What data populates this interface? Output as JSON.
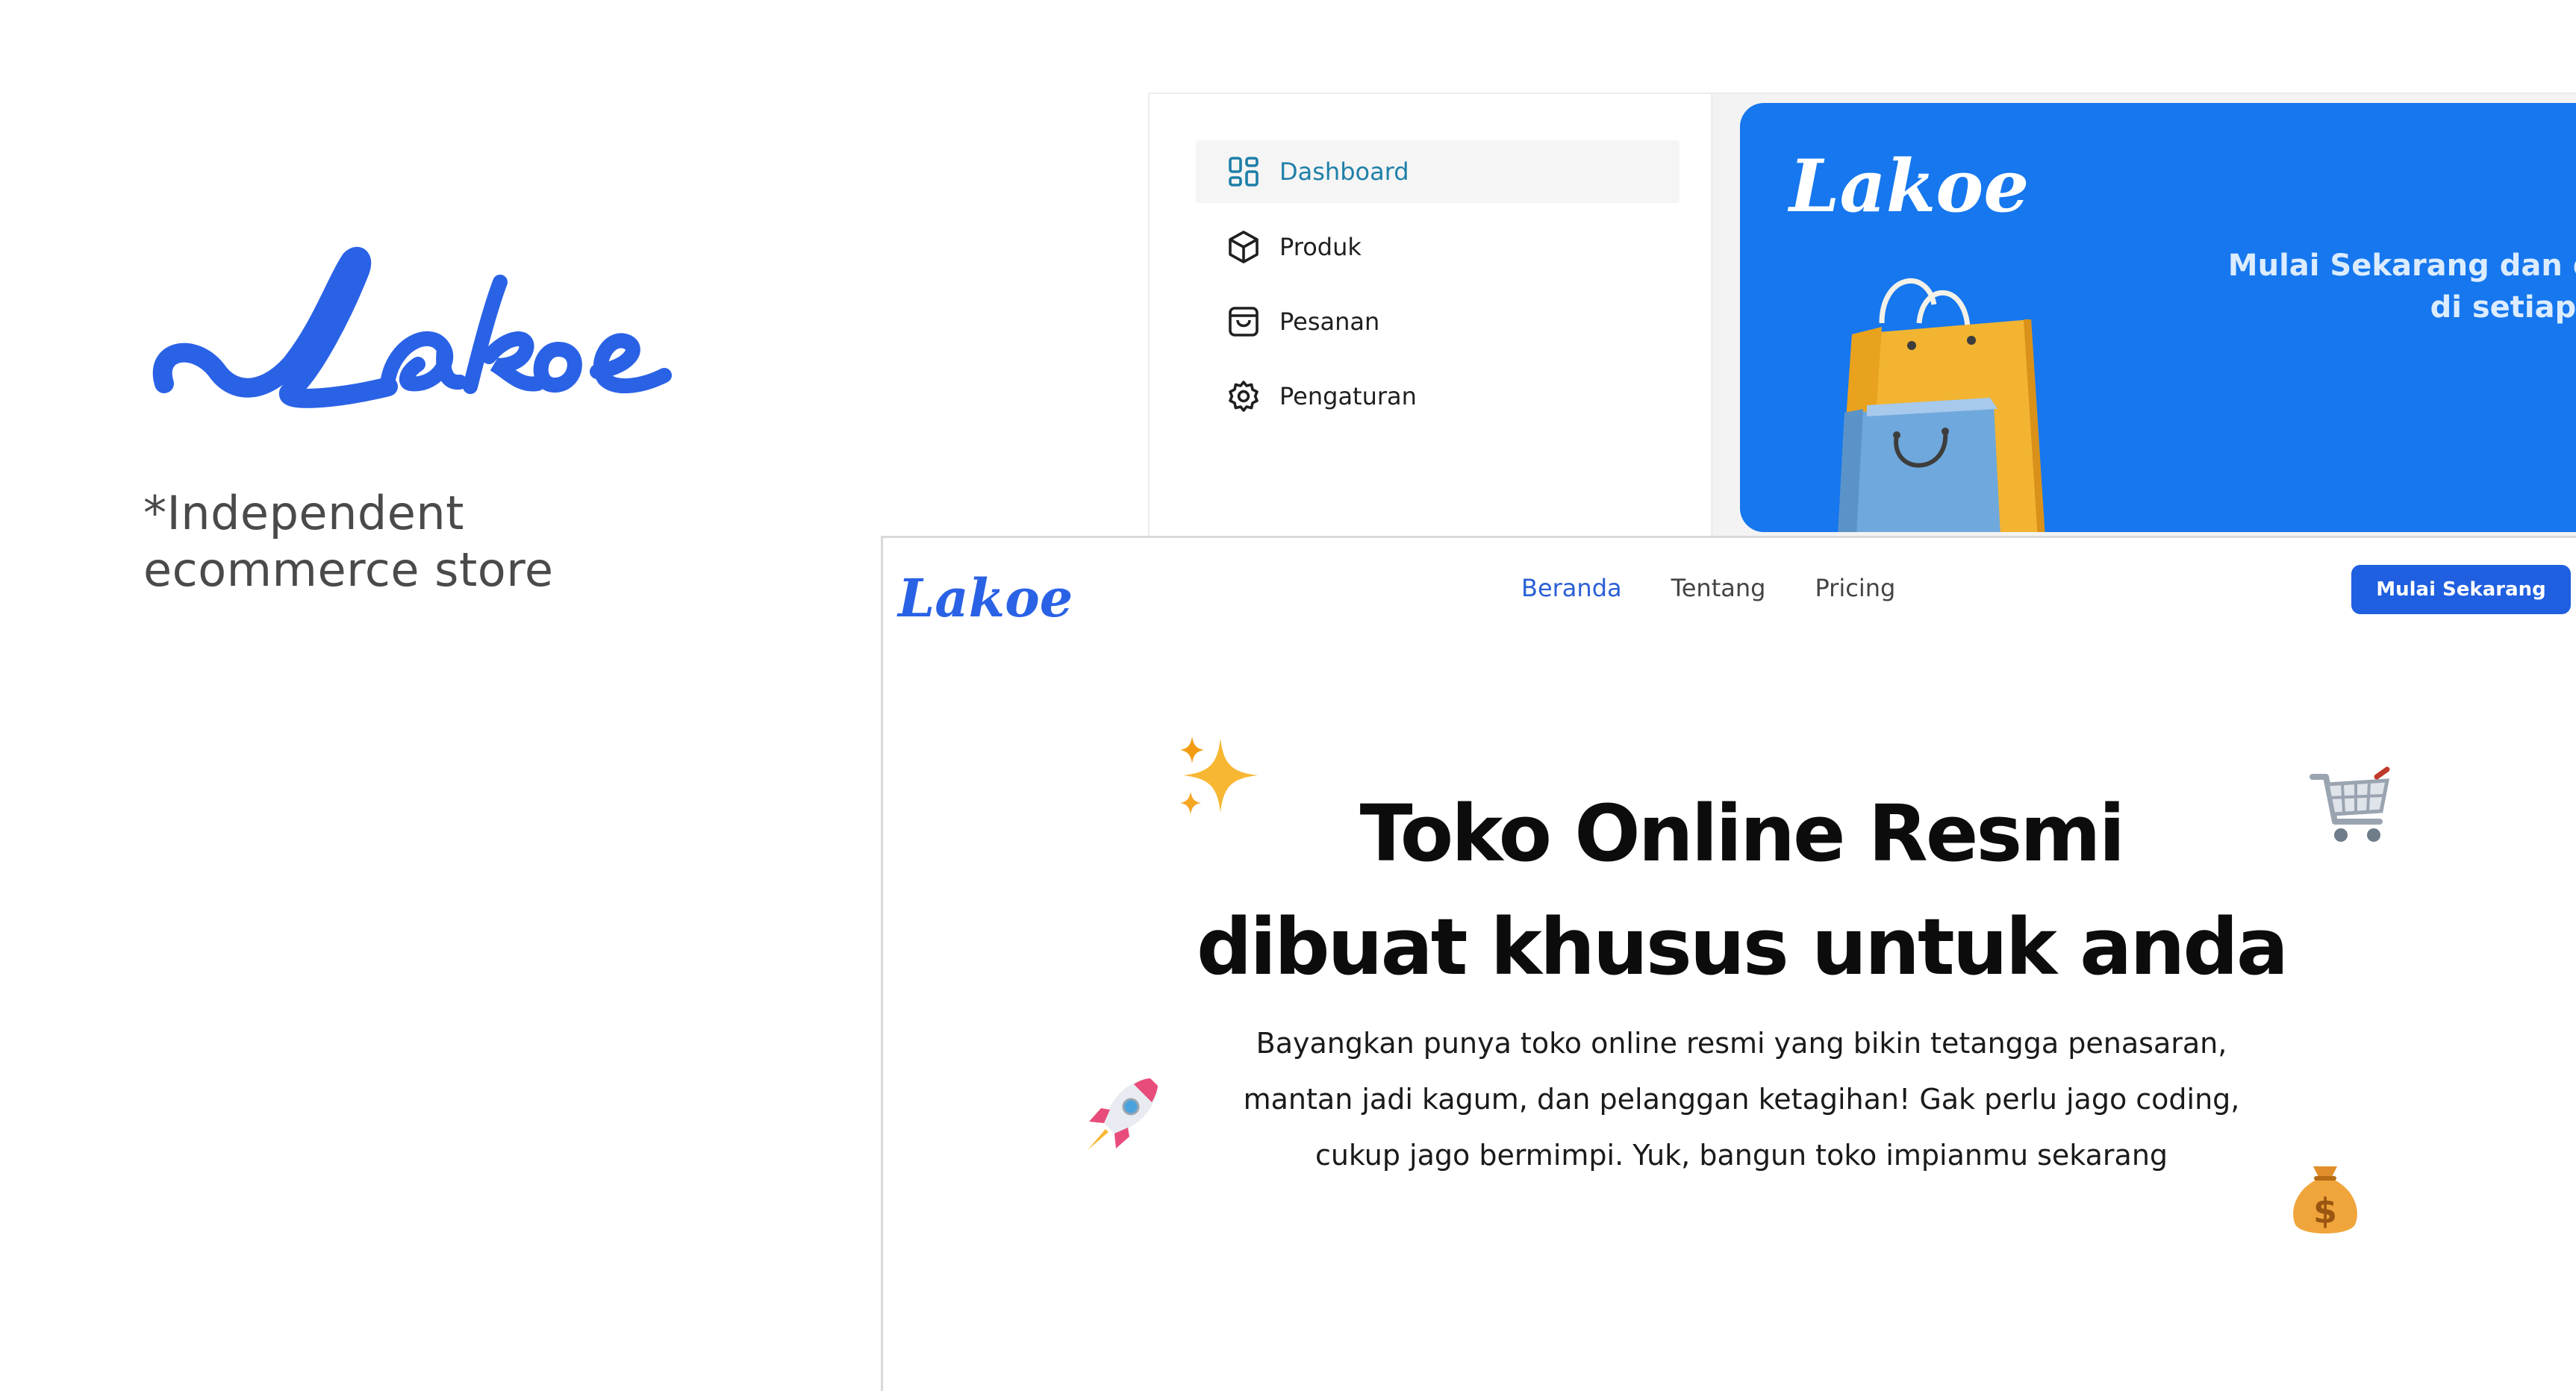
{
  "brand": {
    "name": "Lakoe",
    "tagline": "*Independent ecommerce store",
    "color": "#2a62e6"
  },
  "dashboard": {
    "menu": [
      {
        "label": "Dashboard",
        "icon": "dashboard-grid-icon",
        "active": true
      },
      {
        "label": "Produk",
        "icon": "box-icon",
        "active": false
      },
      {
        "label": "Pesanan",
        "icon": "shopping-bag-icon",
        "active": false
      },
      {
        "label": "Pengaturan",
        "icon": "gear-icon",
        "active": false
      }
    ],
    "banner": {
      "logo": "Lakoe",
      "line1": "Mulai Sekarang dan dap",
      "line2": "di setiap tra",
      "background": "#1677ee"
    }
  },
  "landing": {
    "logo": "Lakoe",
    "nav": [
      {
        "label": "Beranda",
        "active": true
      },
      {
        "label": "Tentang",
        "active": false
      },
      {
        "label": "Pricing",
        "active": false
      }
    ],
    "cta_label": "Mulai Sekarang",
    "hero_title_line1": "Toko Online Resmi",
    "hero_title_line2": "dibuat khusus untuk anda",
    "hero_desc_line1": "Bayangkan punya toko online resmi yang bikin tetangga penasaran,",
    "hero_desc_line2": "mantan jadi kagum, dan pelanggan ketagihan! Gak perlu jago coding,",
    "hero_desc_line3": "cukup jago bermimpi. Yuk, bangun toko impianmu sekarang",
    "decorations": [
      "sparkles-icon",
      "shopping-cart-icon",
      "rocket-icon",
      "money-bag-icon"
    ],
    "accent": "#1f5fe0"
  }
}
